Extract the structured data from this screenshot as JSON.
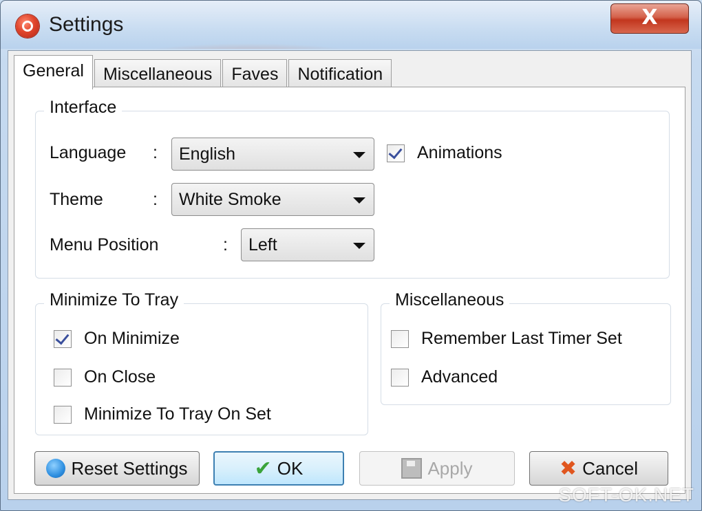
{
  "window": {
    "title": "Settings",
    "close_label": "X"
  },
  "tabs": [
    {
      "label": "General"
    },
    {
      "label": "Miscellaneous"
    },
    {
      "label": "Faves"
    },
    {
      "label": "Notification"
    }
  ],
  "interface": {
    "title": "Interface",
    "language_label": "Language",
    "language_value": "English",
    "theme_label": "Theme",
    "theme_value": "White Smoke",
    "menu_position_label": "Menu Position",
    "menu_position_value": "Left",
    "separator": ":",
    "animations_label": "Animations",
    "animations_checked": true
  },
  "tray": {
    "title": "Minimize To Tray",
    "items": [
      {
        "label": "On Minimize",
        "checked": true
      },
      {
        "label": "On Close",
        "checked": false
      },
      {
        "label": "Minimize To Tray On Set",
        "checked": false
      }
    ]
  },
  "misc": {
    "title": "Miscellaneous",
    "items": [
      {
        "label": "Remember Last Timer Set",
        "checked": false
      },
      {
        "label": "Advanced",
        "checked": false
      }
    ]
  },
  "buttons": {
    "reset": "Reset Settings",
    "ok": "OK",
    "apply": "Apply",
    "cancel": "Cancel"
  },
  "watermark": "SOFT-OK.NET"
}
